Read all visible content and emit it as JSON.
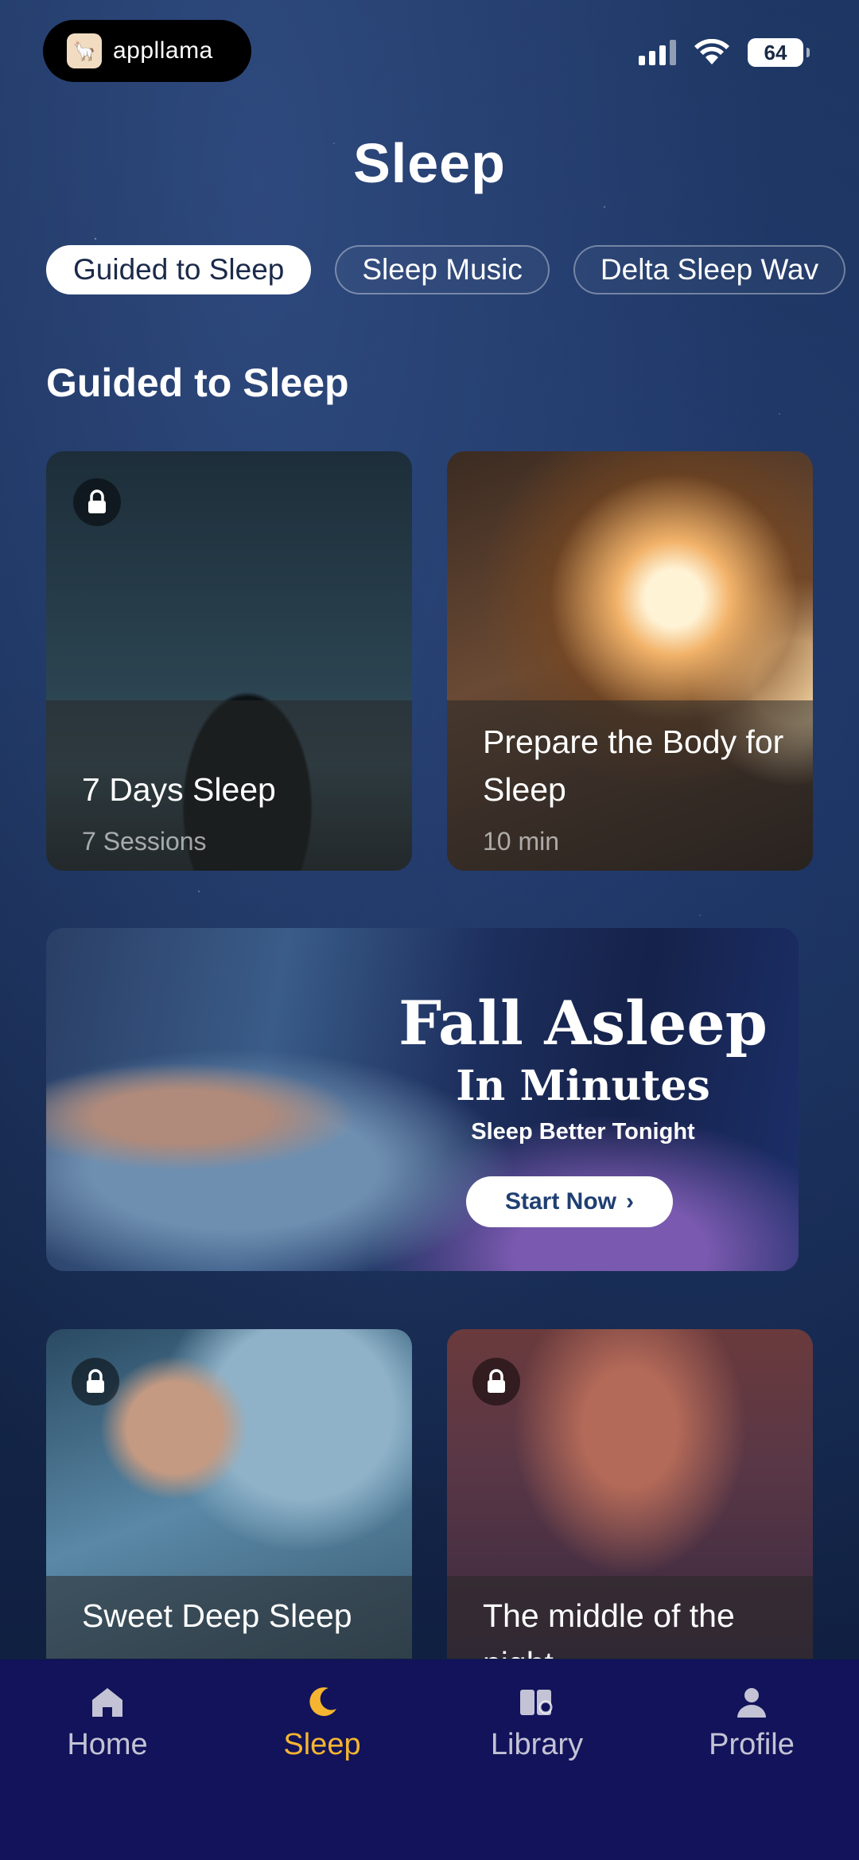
{
  "status_bar": {
    "app_name": "appllama",
    "battery": "64"
  },
  "page": {
    "title": "Sleep"
  },
  "tabs": [
    {
      "label": "Guided to Sleep",
      "active": true
    },
    {
      "label": "Sleep Music",
      "active": false
    },
    {
      "label": "Delta Sleep Wav",
      "active": false
    }
  ],
  "section": {
    "title": "Guided to Sleep"
  },
  "cards": [
    {
      "title": "7 Days Sleep",
      "subtitle": "7 Sessions",
      "locked": true
    },
    {
      "title": "Prepare the Body for Sleep",
      "subtitle": "10 min",
      "locked": false
    },
    {
      "title": "Sweet Deep Sleep",
      "subtitle": "",
      "locked": true
    },
    {
      "title": "The middle of the night",
      "subtitle": "",
      "locked": true
    }
  ],
  "banner": {
    "headline": "Fall Asleep",
    "subheadline": "In Minutes",
    "tagline": "Sleep Better Tonight",
    "cta": "Start Now",
    "cta_chevron": "›"
  },
  "bottom_nav": [
    {
      "label": "Home",
      "icon": "home-icon",
      "active": false
    },
    {
      "label": "Sleep",
      "icon": "moon-icon",
      "active": true
    },
    {
      "label": "Library",
      "icon": "library-icon",
      "active": false
    },
    {
      "label": "Profile",
      "icon": "profile-icon",
      "active": false
    }
  ],
  "colors": {
    "accent": "#f5b531",
    "nav_background": "#12135a",
    "background": "#1a3059"
  }
}
